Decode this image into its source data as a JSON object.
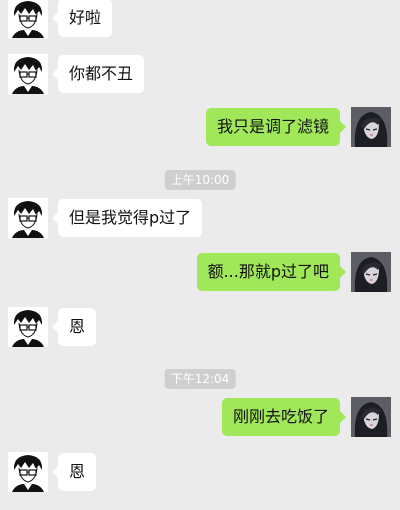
{
  "messages": [
    {
      "side": "in",
      "text": "好啦"
    },
    {
      "side": "in",
      "text": "你都不丑"
    },
    {
      "side": "out",
      "text": "我只是调了滤镜"
    },
    {
      "side": "time",
      "text": "上午10:00"
    },
    {
      "side": "in",
      "text": "但是我觉得p过了"
    },
    {
      "side": "out",
      "text": "额...那就p过了吧"
    },
    {
      "side": "in",
      "text": "恩"
    },
    {
      "side": "time",
      "text": "下午12:04"
    },
    {
      "side": "out",
      "text": "刚刚去吃饭了"
    },
    {
      "side": "in",
      "text": "恩"
    }
  ],
  "colors": {
    "background": "#ebebeb",
    "incoming_bubble": "#ffffff",
    "outgoing_bubble": "#a0e75a",
    "timestamp_bg": "#cfcfcf"
  },
  "avatars": {
    "incoming": "anime-boy-avatar",
    "outgoing": "anime-girl-avatar"
  }
}
